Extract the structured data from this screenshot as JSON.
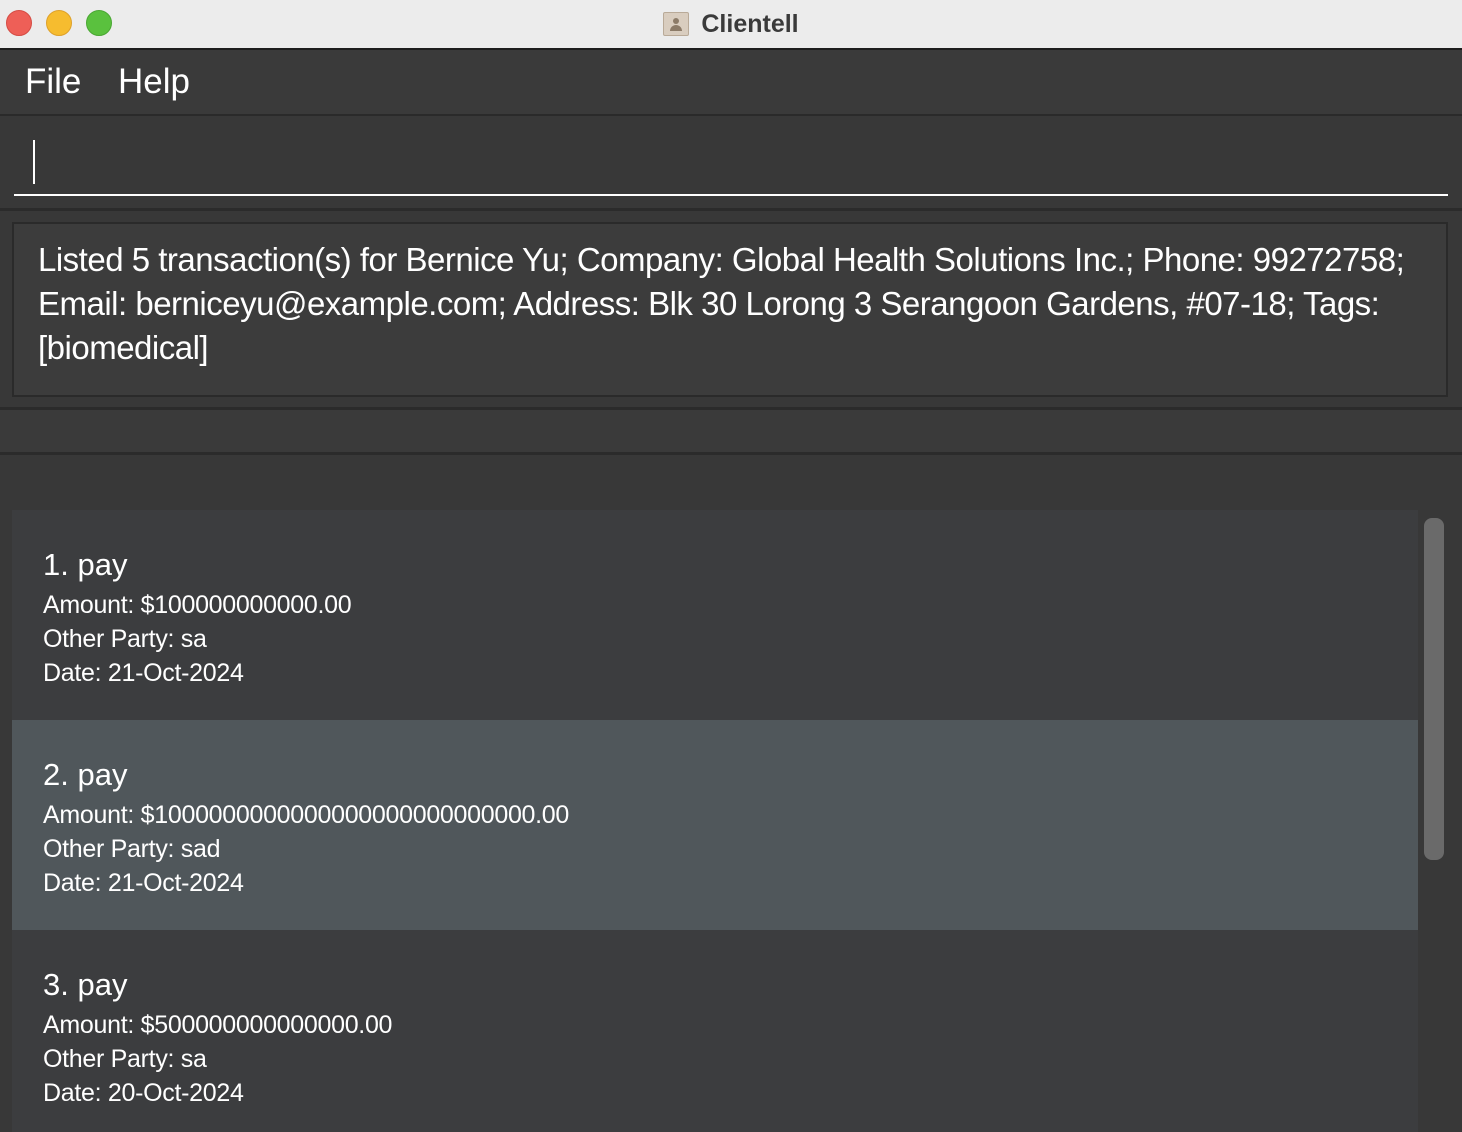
{
  "window": {
    "title": "Clientell"
  },
  "menu": {
    "items": [
      {
        "label": "File"
      },
      {
        "label": "Help"
      }
    ]
  },
  "command": {
    "value": "",
    "placeholder": ""
  },
  "result": {
    "message": "Listed 5 transaction(s) for Bernice Yu; Company: Global Health Solutions Inc.; Phone: 99272758; Email: berniceyu@example.com; Address: Blk 30 Lorong 3 Serangoon Gardens, #07-18; Tags: [biomedical]"
  },
  "transactions": [
    {
      "title": "1. pay",
      "amount": "Amount: $100000000000.00",
      "other_party": "Other Party: sa",
      "date": "Date: 21-Oct-2024"
    },
    {
      "title": "2. pay",
      "amount": "Amount: $1000000000000000000000000000.00",
      "other_party": "Other Party: sad",
      "date": "Date: 21-Oct-2024"
    },
    {
      "title": "3. pay",
      "amount": "Amount: $500000000000000.00",
      "other_party": "Other Party: sa",
      "date": "Date: 20-Oct-2024"
    }
  ],
  "icons": {
    "app": "contact-card-icon"
  },
  "colors": {
    "background": "#383838",
    "selected_card": "#50575b",
    "card": "#3c3d3f",
    "text": "#ffffff",
    "close": "#ee5f57",
    "minimize": "#f6bc2f",
    "maximize": "#5ac13e"
  }
}
